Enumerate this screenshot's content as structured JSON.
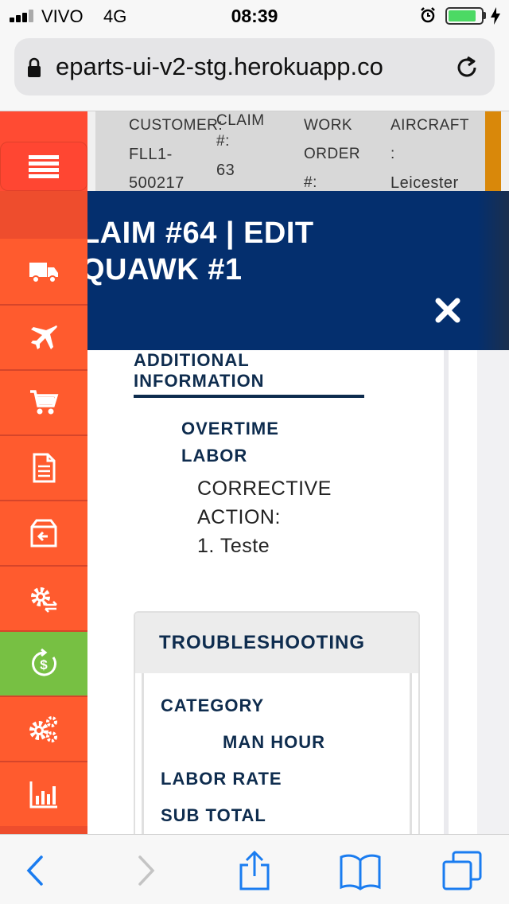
{
  "status_bar": {
    "carrier": "VIVO",
    "network": "4G",
    "time": "08:39",
    "battery_level": 0.85
  },
  "browser": {
    "url": "eparts-ui-v2-stg.herokuapp.co"
  },
  "background_page": {
    "customer_label": "CUSTOMER:",
    "customer_value_1": "FLL1-",
    "customer_value_2": "500217",
    "claim_label_1": "CLAIM",
    "claim_label_2": "#:",
    "claim_value": "63",
    "work_order_label_1": "WORK",
    "work_order_label_2": "ORDER",
    "work_order_label_3": "#:",
    "aircraft_label_1": "AIRCRAFT",
    "aircraft_label_2": ":",
    "aircraft_value": "Leicester"
  },
  "sidebar": {
    "items": [
      {
        "icon": "truck-icon"
      },
      {
        "icon": "airplane-icon"
      },
      {
        "icon": "cart-icon"
      },
      {
        "icon": "document-icon"
      },
      {
        "icon": "box-return-icon"
      },
      {
        "icon": "gear-exchange-icon"
      },
      {
        "icon": "money-refresh-icon"
      },
      {
        "icon": "gears-icon"
      },
      {
        "icon": "bar-chart-icon"
      }
    ],
    "active_color": "#77c043",
    "accent_color": "#ff5b2e"
  },
  "modal": {
    "title_line1": "LAIM #64 | EDIT",
    "title_line2": "QUAWK #1",
    "header_color": "#042f6e",
    "section_heading_1": "ADDITIONAL",
    "section_heading_2": "INFORMATION",
    "overtime_label_1": "OVERTIME",
    "overtime_label_2": "LABOR",
    "corrective_line1": "CORRECTIVE",
    "corrective_line2": "ACTION:",
    "corrective_line3": "1. Teste",
    "troubleshooting": {
      "title": "TROUBLESHOOTING",
      "category_label": "CATEGORY",
      "man_hour_label": "MAN HOUR",
      "labor_rate_label": "LABOR RATE",
      "sub_total_label": "SUB TOTAL"
    }
  }
}
